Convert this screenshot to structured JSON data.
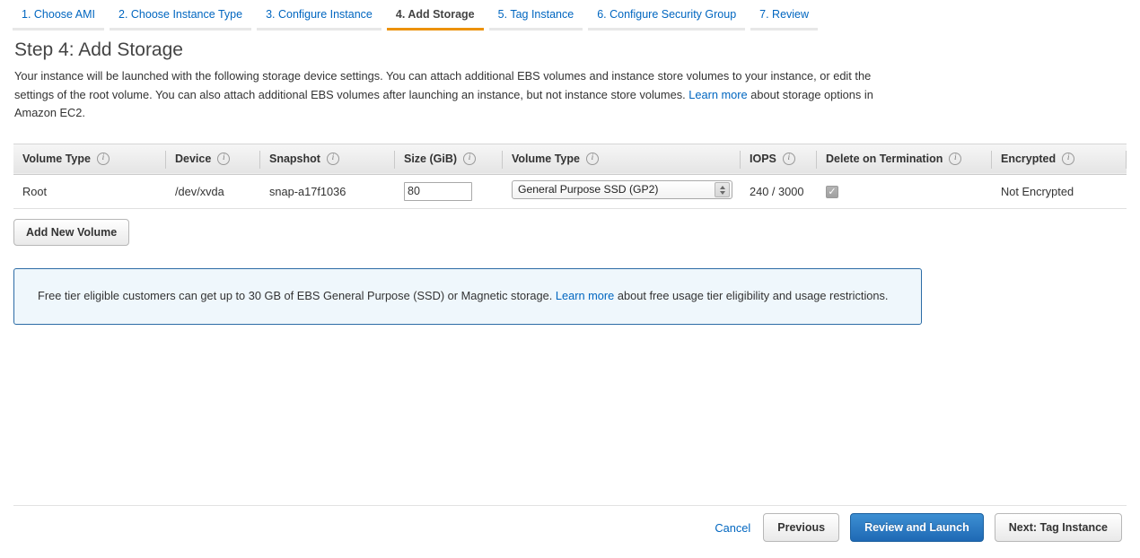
{
  "wizard": {
    "tabs": [
      {
        "label": "1. Choose AMI",
        "active": false
      },
      {
        "label": "2. Choose Instance Type",
        "active": false
      },
      {
        "label": "3. Configure Instance",
        "active": false
      },
      {
        "label": "4. Add Storage",
        "active": true
      },
      {
        "label": "5. Tag Instance",
        "active": false
      },
      {
        "label": "6. Configure Security Group",
        "active": false
      },
      {
        "label": "7. Review",
        "active": false
      }
    ],
    "active_color": "#ec9209",
    "link_color": "#0066c0"
  },
  "page": {
    "title": "Step 4: Add Storage",
    "description_part1": "Your instance will be launched with the following storage device settings. You can attach additional EBS volumes and instance store volumes to your instance, or edit the settings of the root volume. You can also attach additional EBS volumes after launching an instance, but not instance store volumes. ",
    "description_link": "Learn more",
    "description_part2": " about storage options in Amazon EC2."
  },
  "table": {
    "columns": [
      {
        "label": "Volume Type",
        "info": "info-icon"
      },
      {
        "label": "Device",
        "info": "info-icon"
      },
      {
        "label": "Snapshot",
        "info": "info-icon"
      },
      {
        "label": "Size (GiB)",
        "info": "info-icon"
      },
      {
        "label": "Volume Type",
        "info": "info-icon"
      },
      {
        "label": "IOPS",
        "info": "info-icon"
      },
      {
        "label": "Delete on Termination",
        "info": "info-icon"
      },
      {
        "label": "Encrypted",
        "info": "info-icon"
      }
    ],
    "rows": [
      {
        "volume_type": "Root",
        "device": "/dev/xvda",
        "snapshot": "snap-a17f1036",
        "size": "80",
        "volume_type_select": "General Purpose SSD (GP2)",
        "iops": "240 / 3000",
        "delete_on_termination_checked": true,
        "delete_on_termination_mark": "✓",
        "encrypted": "Not Encrypted"
      }
    ]
  },
  "buttons": {
    "add_new_volume": "Add New Volume",
    "cancel": "Cancel",
    "previous": "Previous",
    "review_and_launch": "Review and Launch",
    "next": "Next: Tag Instance"
  },
  "notice": {
    "text_part1": "Free tier eligible customers can get up to 30 GB of EBS General Purpose (SSD) or Magnetic storage. ",
    "link": "Learn more",
    "text_part2": " about free usage tier eligibility and usage restrictions.",
    "border_color": "#2c6ca6",
    "background_color": "#eff7fc"
  }
}
